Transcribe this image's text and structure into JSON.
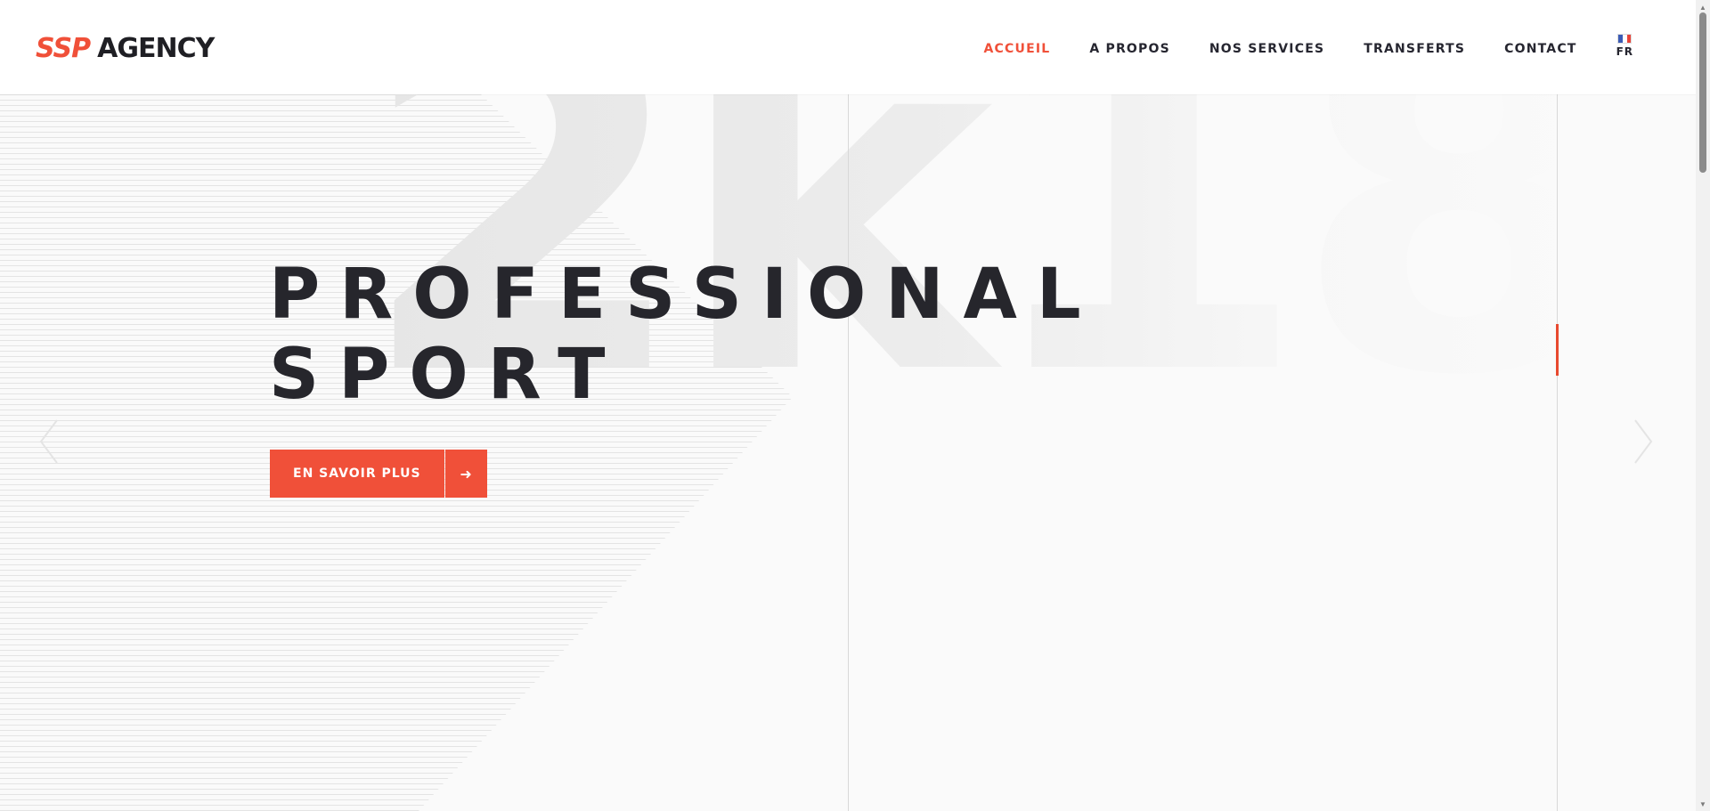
{
  "brand": {
    "ssp": "SSP",
    "agency": "AGENCY",
    "accent_color": "#f05039",
    "dark_color": "#26262c"
  },
  "nav": {
    "items": [
      {
        "label": "ACCUEIL",
        "active": true
      },
      {
        "label": "A PROPOS",
        "active": false
      },
      {
        "label": "NOS SERVICES",
        "active": false
      },
      {
        "label": "TRANSFERTS",
        "active": false
      },
      {
        "label": "CONTACT",
        "active": false
      }
    ],
    "language": {
      "label": "FR",
      "icon": "france-flag-icon"
    }
  },
  "hero": {
    "watermark": "2k18",
    "title_line1": "PROFESSIONAL",
    "title_line2": "SPORT",
    "cta_label": "EN SAVOIR PLUS",
    "cta_icon": "arrow-right-icon",
    "prev_icon": "chevron-left-icon",
    "next_icon": "chevron-right-icon"
  }
}
